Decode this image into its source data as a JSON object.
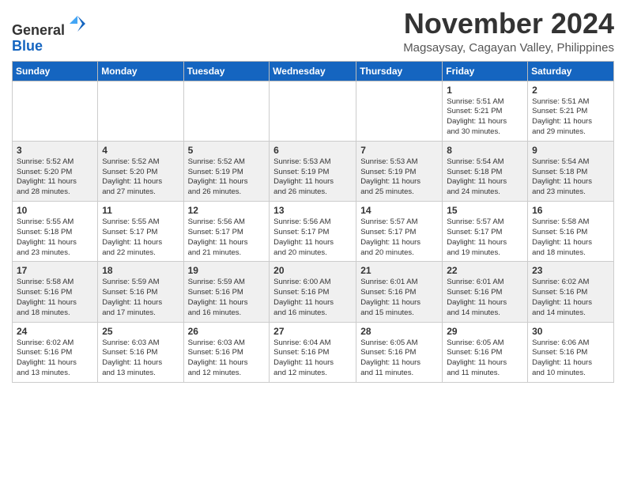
{
  "header": {
    "logo_general": "General",
    "logo_blue": "Blue",
    "month": "November 2024",
    "location": "Magsaysay, Cagayan Valley, Philippines"
  },
  "weekdays": [
    "Sunday",
    "Monday",
    "Tuesday",
    "Wednesday",
    "Thursday",
    "Friday",
    "Saturday"
  ],
  "weeks": [
    [
      {
        "day": "",
        "info": ""
      },
      {
        "day": "",
        "info": ""
      },
      {
        "day": "",
        "info": ""
      },
      {
        "day": "",
        "info": ""
      },
      {
        "day": "",
        "info": ""
      },
      {
        "day": "1",
        "info": "Sunrise: 5:51 AM\nSunset: 5:21 PM\nDaylight: 11 hours\nand 30 minutes."
      },
      {
        "day": "2",
        "info": "Sunrise: 5:51 AM\nSunset: 5:21 PM\nDaylight: 11 hours\nand 29 minutes."
      }
    ],
    [
      {
        "day": "3",
        "info": "Sunrise: 5:52 AM\nSunset: 5:20 PM\nDaylight: 11 hours\nand 28 minutes."
      },
      {
        "day": "4",
        "info": "Sunrise: 5:52 AM\nSunset: 5:20 PM\nDaylight: 11 hours\nand 27 minutes."
      },
      {
        "day": "5",
        "info": "Sunrise: 5:52 AM\nSunset: 5:19 PM\nDaylight: 11 hours\nand 26 minutes."
      },
      {
        "day": "6",
        "info": "Sunrise: 5:53 AM\nSunset: 5:19 PM\nDaylight: 11 hours\nand 26 minutes."
      },
      {
        "day": "7",
        "info": "Sunrise: 5:53 AM\nSunset: 5:19 PM\nDaylight: 11 hours\nand 25 minutes."
      },
      {
        "day": "8",
        "info": "Sunrise: 5:54 AM\nSunset: 5:18 PM\nDaylight: 11 hours\nand 24 minutes."
      },
      {
        "day": "9",
        "info": "Sunrise: 5:54 AM\nSunset: 5:18 PM\nDaylight: 11 hours\nand 23 minutes."
      }
    ],
    [
      {
        "day": "10",
        "info": "Sunrise: 5:55 AM\nSunset: 5:18 PM\nDaylight: 11 hours\nand 23 minutes."
      },
      {
        "day": "11",
        "info": "Sunrise: 5:55 AM\nSunset: 5:17 PM\nDaylight: 11 hours\nand 22 minutes."
      },
      {
        "day": "12",
        "info": "Sunrise: 5:56 AM\nSunset: 5:17 PM\nDaylight: 11 hours\nand 21 minutes."
      },
      {
        "day": "13",
        "info": "Sunrise: 5:56 AM\nSunset: 5:17 PM\nDaylight: 11 hours\nand 20 minutes."
      },
      {
        "day": "14",
        "info": "Sunrise: 5:57 AM\nSunset: 5:17 PM\nDaylight: 11 hours\nand 20 minutes."
      },
      {
        "day": "15",
        "info": "Sunrise: 5:57 AM\nSunset: 5:17 PM\nDaylight: 11 hours\nand 19 minutes."
      },
      {
        "day": "16",
        "info": "Sunrise: 5:58 AM\nSunset: 5:16 PM\nDaylight: 11 hours\nand 18 minutes."
      }
    ],
    [
      {
        "day": "17",
        "info": "Sunrise: 5:58 AM\nSunset: 5:16 PM\nDaylight: 11 hours\nand 18 minutes."
      },
      {
        "day": "18",
        "info": "Sunrise: 5:59 AM\nSunset: 5:16 PM\nDaylight: 11 hours\nand 17 minutes."
      },
      {
        "day": "19",
        "info": "Sunrise: 5:59 AM\nSunset: 5:16 PM\nDaylight: 11 hours\nand 16 minutes."
      },
      {
        "day": "20",
        "info": "Sunrise: 6:00 AM\nSunset: 5:16 PM\nDaylight: 11 hours\nand 16 minutes."
      },
      {
        "day": "21",
        "info": "Sunrise: 6:01 AM\nSunset: 5:16 PM\nDaylight: 11 hours\nand 15 minutes."
      },
      {
        "day": "22",
        "info": "Sunrise: 6:01 AM\nSunset: 5:16 PM\nDaylight: 11 hours\nand 14 minutes."
      },
      {
        "day": "23",
        "info": "Sunrise: 6:02 AM\nSunset: 5:16 PM\nDaylight: 11 hours\nand 14 minutes."
      }
    ],
    [
      {
        "day": "24",
        "info": "Sunrise: 6:02 AM\nSunset: 5:16 PM\nDaylight: 11 hours\nand 13 minutes."
      },
      {
        "day": "25",
        "info": "Sunrise: 6:03 AM\nSunset: 5:16 PM\nDaylight: 11 hours\nand 13 minutes."
      },
      {
        "day": "26",
        "info": "Sunrise: 6:03 AM\nSunset: 5:16 PM\nDaylight: 11 hours\nand 12 minutes."
      },
      {
        "day": "27",
        "info": "Sunrise: 6:04 AM\nSunset: 5:16 PM\nDaylight: 11 hours\nand 12 minutes."
      },
      {
        "day": "28",
        "info": "Sunrise: 6:05 AM\nSunset: 5:16 PM\nDaylight: 11 hours\nand 11 minutes."
      },
      {
        "day": "29",
        "info": "Sunrise: 6:05 AM\nSunset: 5:16 PM\nDaylight: 11 hours\nand 11 minutes."
      },
      {
        "day": "30",
        "info": "Sunrise: 6:06 AM\nSunset: 5:16 PM\nDaylight: 11 hours\nand 10 minutes."
      }
    ]
  ]
}
